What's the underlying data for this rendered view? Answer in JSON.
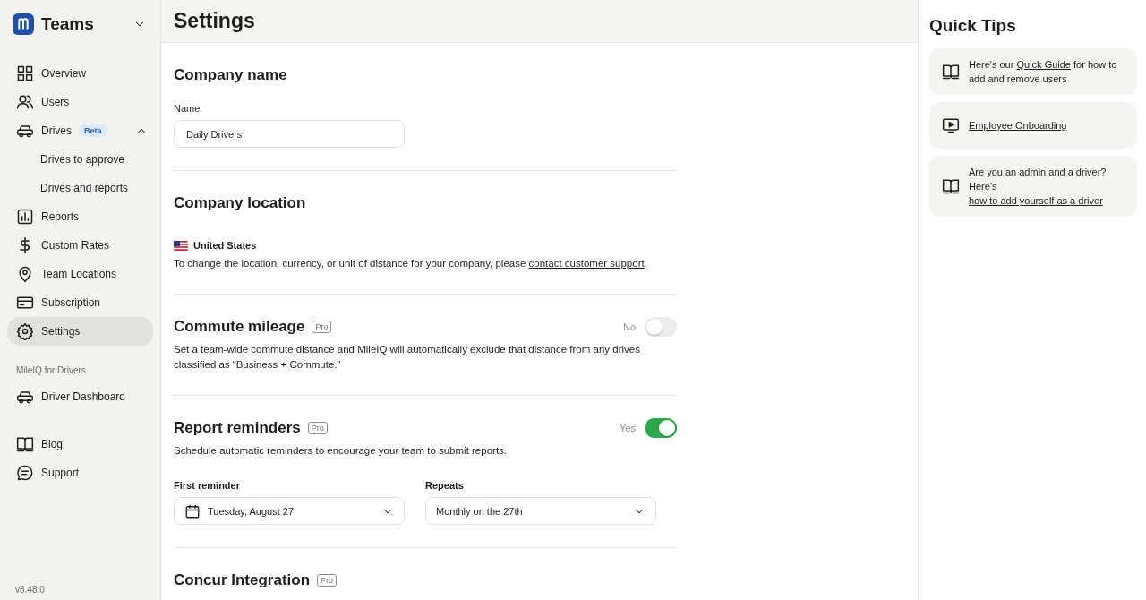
{
  "sidebar": {
    "brand": "Teams",
    "items": [
      {
        "label": "Overview",
        "kind": "grid",
        "selected": false
      },
      {
        "label": "Users",
        "kind": "users",
        "selected": false
      },
      {
        "label": "Drives",
        "kind": "car",
        "selected": false,
        "badge": "Beta",
        "expanded": true,
        "children": [
          {
            "label": "Drives to approve",
            "selected": false
          },
          {
            "label": "Drives and reports",
            "selected": false
          }
        ]
      },
      {
        "label": "Reports",
        "kind": "chart",
        "selected": false
      },
      {
        "label": "Custom Rates",
        "kind": "dollar",
        "selected": false
      },
      {
        "label": "Team Locations",
        "kind": "pin",
        "selected": false
      },
      {
        "label": "Subscription",
        "kind": "card",
        "selected": false
      },
      {
        "label": "Settings",
        "kind": "gear",
        "selected": true
      }
    ],
    "section_label": "MileIQ for Drivers",
    "driver_items": [
      {
        "label": "Driver Dashboard",
        "kind": "car",
        "selected": false
      }
    ],
    "footer_items": [
      {
        "label": "Blog",
        "kind": "book",
        "selected": false
      },
      {
        "label": "Support",
        "kind": "chat",
        "selected": false
      }
    ],
    "version": "v3.48.0"
  },
  "page_title": "Settings",
  "sections": [
    {
      "kind": "name",
      "title": "Company name",
      "label": "Name",
      "value": "Daily Drivers"
    },
    {
      "kind": "location",
      "title": "Company location",
      "country": "United States",
      "before": "To change the location, currency, or unit of distance for your company, please ",
      "link": "contact customer support",
      "after": "."
    },
    {
      "kind": "toggle",
      "title": "Commute mileage",
      "badge": "Pro",
      "toggle_label": "No",
      "on": false,
      "description": "Set a team-wide commute distance and MileIQ will automatically exclude that distance from any drives classified as “Business + Commute.”"
    },
    {
      "kind": "toggle",
      "title": "Report reminders",
      "badge": "Pro",
      "toggle_label": "Yes",
      "on": true,
      "description": "Schedule automatic reminders to encourage your team to submit reports.",
      "fields": [
        {
          "label": "First reminder",
          "value": "Tuesday, August 27",
          "kind": "date"
        },
        {
          "label": "Repeats",
          "value": "Monthly on the 27th",
          "kind": "select"
        }
      ]
    },
    {
      "kind": "heading",
      "title": "Concur Integration",
      "badge": "Pro"
    }
  ],
  "quick_tips": {
    "title": "Quick Tips",
    "tips": [
      {
        "kind": "guide",
        "before": "Here's our ",
        "link": "Quick Guide",
        "after": " for how to add and remove users"
      },
      {
        "kind": "video",
        "link": "Employee Onboarding"
      },
      {
        "kind": "guide",
        "before": "Are you an admin and a driver? Here’s ",
        "link": "how to add yourself as a driver"
      }
    ]
  }
}
